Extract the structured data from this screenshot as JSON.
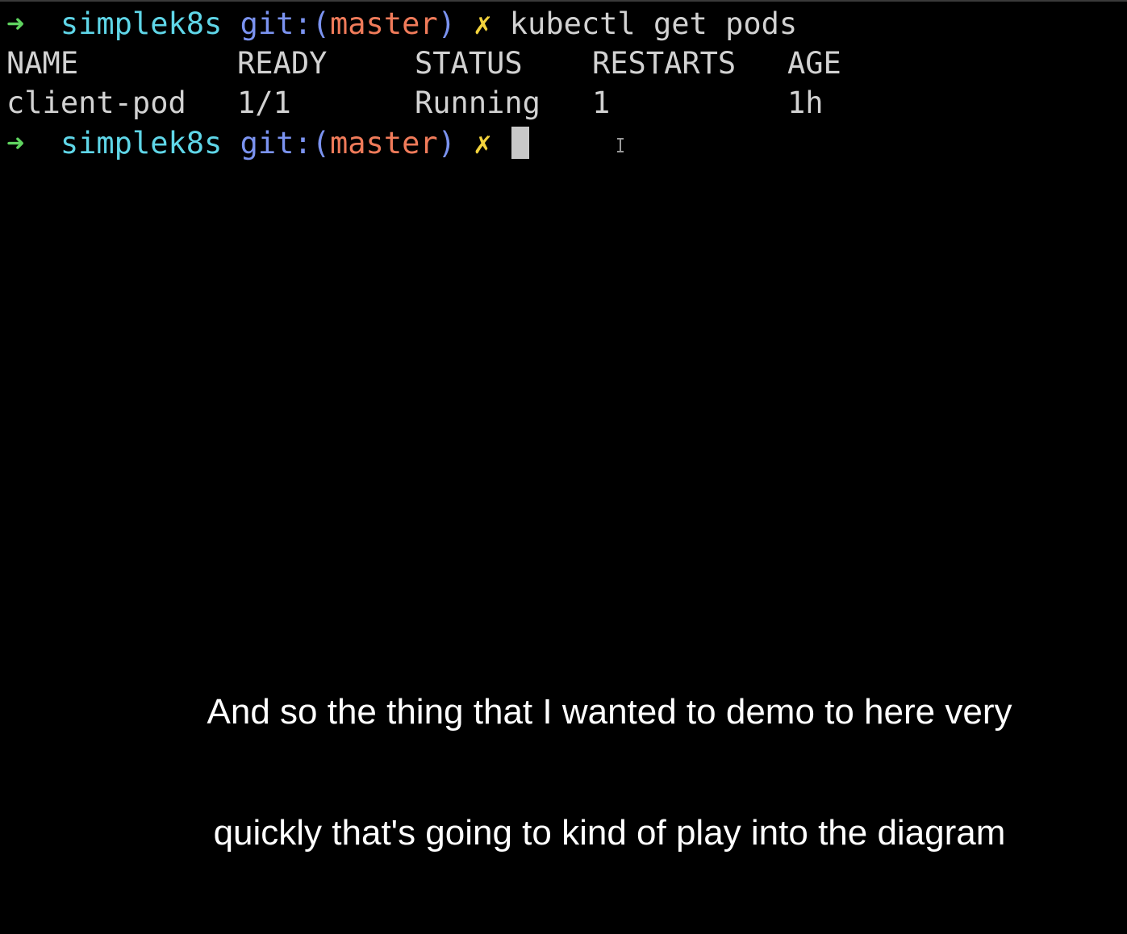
{
  "terminal": {
    "prompt": {
      "arrow": "➜",
      "directory": "simplek8s",
      "git_prefix": "git:(",
      "branch": "master",
      "git_suffix": ")",
      "dirty_marker": "✗"
    },
    "command": "kubectl get pods",
    "table": {
      "headers": [
        "NAME",
        "READY",
        "STATUS",
        "RESTARTS",
        "AGE"
      ],
      "rows": [
        [
          "client-pod",
          "1/1",
          "Running",
          "1",
          "1h"
        ]
      ]
    }
  },
  "subtitle": {
    "line1": "And so the thing that I wanted to demo to here very",
    "line2": "quickly that's going to kind of play into the diagram"
  },
  "colors": {
    "background": "#000000",
    "prompt_arrow": "#5fd35f",
    "directory": "#5fd6e8",
    "git": "#7b93f0",
    "branch": "#f07b5a",
    "dirty_marker": "#f3d33c",
    "text": "#d2d2d2",
    "subtitle": "#ffffff"
  },
  "icons": {
    "cursor": "block-cursor-icon",
    "mouse_pointer": "text-ibeam-cursor-icon"
  }
}
